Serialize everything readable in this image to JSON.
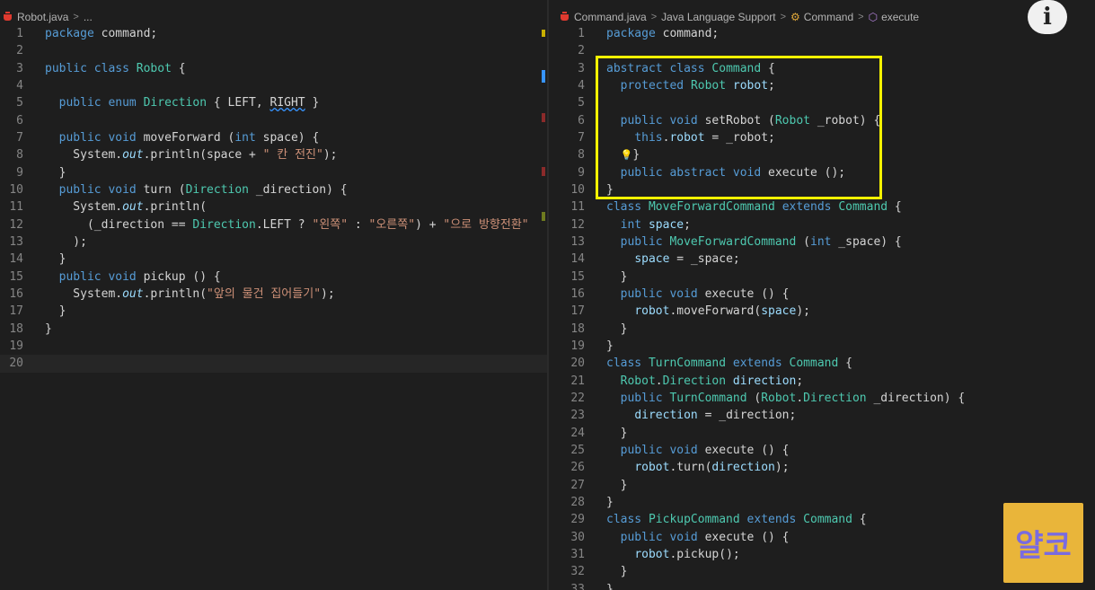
{
  "left_editor": {
    "breadcrumb": {
      "file": "Robot.java",
      "more": "..."
    },
    "lines": [
      "package command;",
      "",
      "public class Robot {",
      "",
      "  public enum Direction { LEFT, RIGHT }",
      "",
      "  public void moveForward (int space) {",
      "    System.out.println(space + \" 칸 전진\");",
      "  }",
      "  public void turn (Direction _direction) {",
      "    System.out.println(",
      "      (_direction == Direction.LEFT ? \"왼쪽\" : \"오른쪽\") + \"으로 방향전환\"",
      "    );",
      "  }",
      "  public void pickup () {",
      "    System.out.println(\"앞의 물건 집어들기\");",
      "  }",
      "}",
      "",
      ""
    ]
  },
  "right_editor": {
    "breadcrumb": {
      "file": "Command.java",
      "language_support": "Java Language Support",
      "class": "Command",
      "method": "execute"
    },
    "lines": [
      "package command;",
      "",
      "abstract class Command {",
      "  protected Robot robot;",
      "",
      "  public void setRobot (Robot _robot) {",
      "    this.robot = _robot;",
      "  }",
      "  public abstract void execute ();",
      "}",
      "class MoveForwardCommand extends Command {",
      "  int space;",
      "  public MoveForwardCommand (int _space) {",
      "    space = _space;",
      "  }",
      "  public void execute () {",
      "    robot.moveForward(space);",
      "  }",
      "}",
      "class TurnCommand extends Command {",
      "  Robot.Direction direction;",
      "  public TurnCommand (Robot.Direction _direction) {",
      "    direction = _direction;",
      "  }",
      "  public void execute () {",
      "    robot.turn(direction);",
      "  }",
      "}",
      "class PickupCommand extends Command {",
      "  public void execute () {",
      "    robot.pickup();",
      "  }",
      "}"
    ]
  },
  "overlay": {
    "info_icon": "i",
    "logo_text": "얄코"
  },
  "colors": {
    "background": "#1e1e1e",
    "keyword": "#569cd6",
    "type": "#4ec9b0",
    "string": "#ce9178",
    "highlight_box": "#f4f200",
    "logo_bg": "#e9b53a"
  }
}
